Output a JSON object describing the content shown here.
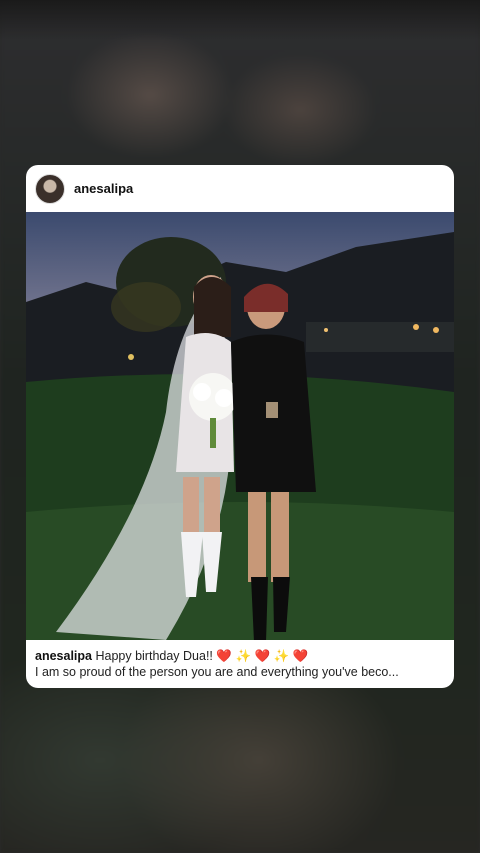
{
  "post": {
    "username": "anesalipa",
    "caption": {
      "username": "anesalipa",
      "line1": "Happy birthday Dua!!",
      "emojis": [
        "❤️",
        "✨",
        "❤️",
        "✨",
        "❤️"
      ],
      "line2": "I am so proud of the person you are and everything you've beco..."
    }
  },
  "icons": {
    "avatar": "profile-avatar",
    "heart": "heart-emoji",
    "sparkles": "sparkles-emoji"
  },
  "colors": {
    "card_bg": "#ffffff",
    "heart": "#e0243a",
    "sparkle": "#f2c12e"
  }
}
